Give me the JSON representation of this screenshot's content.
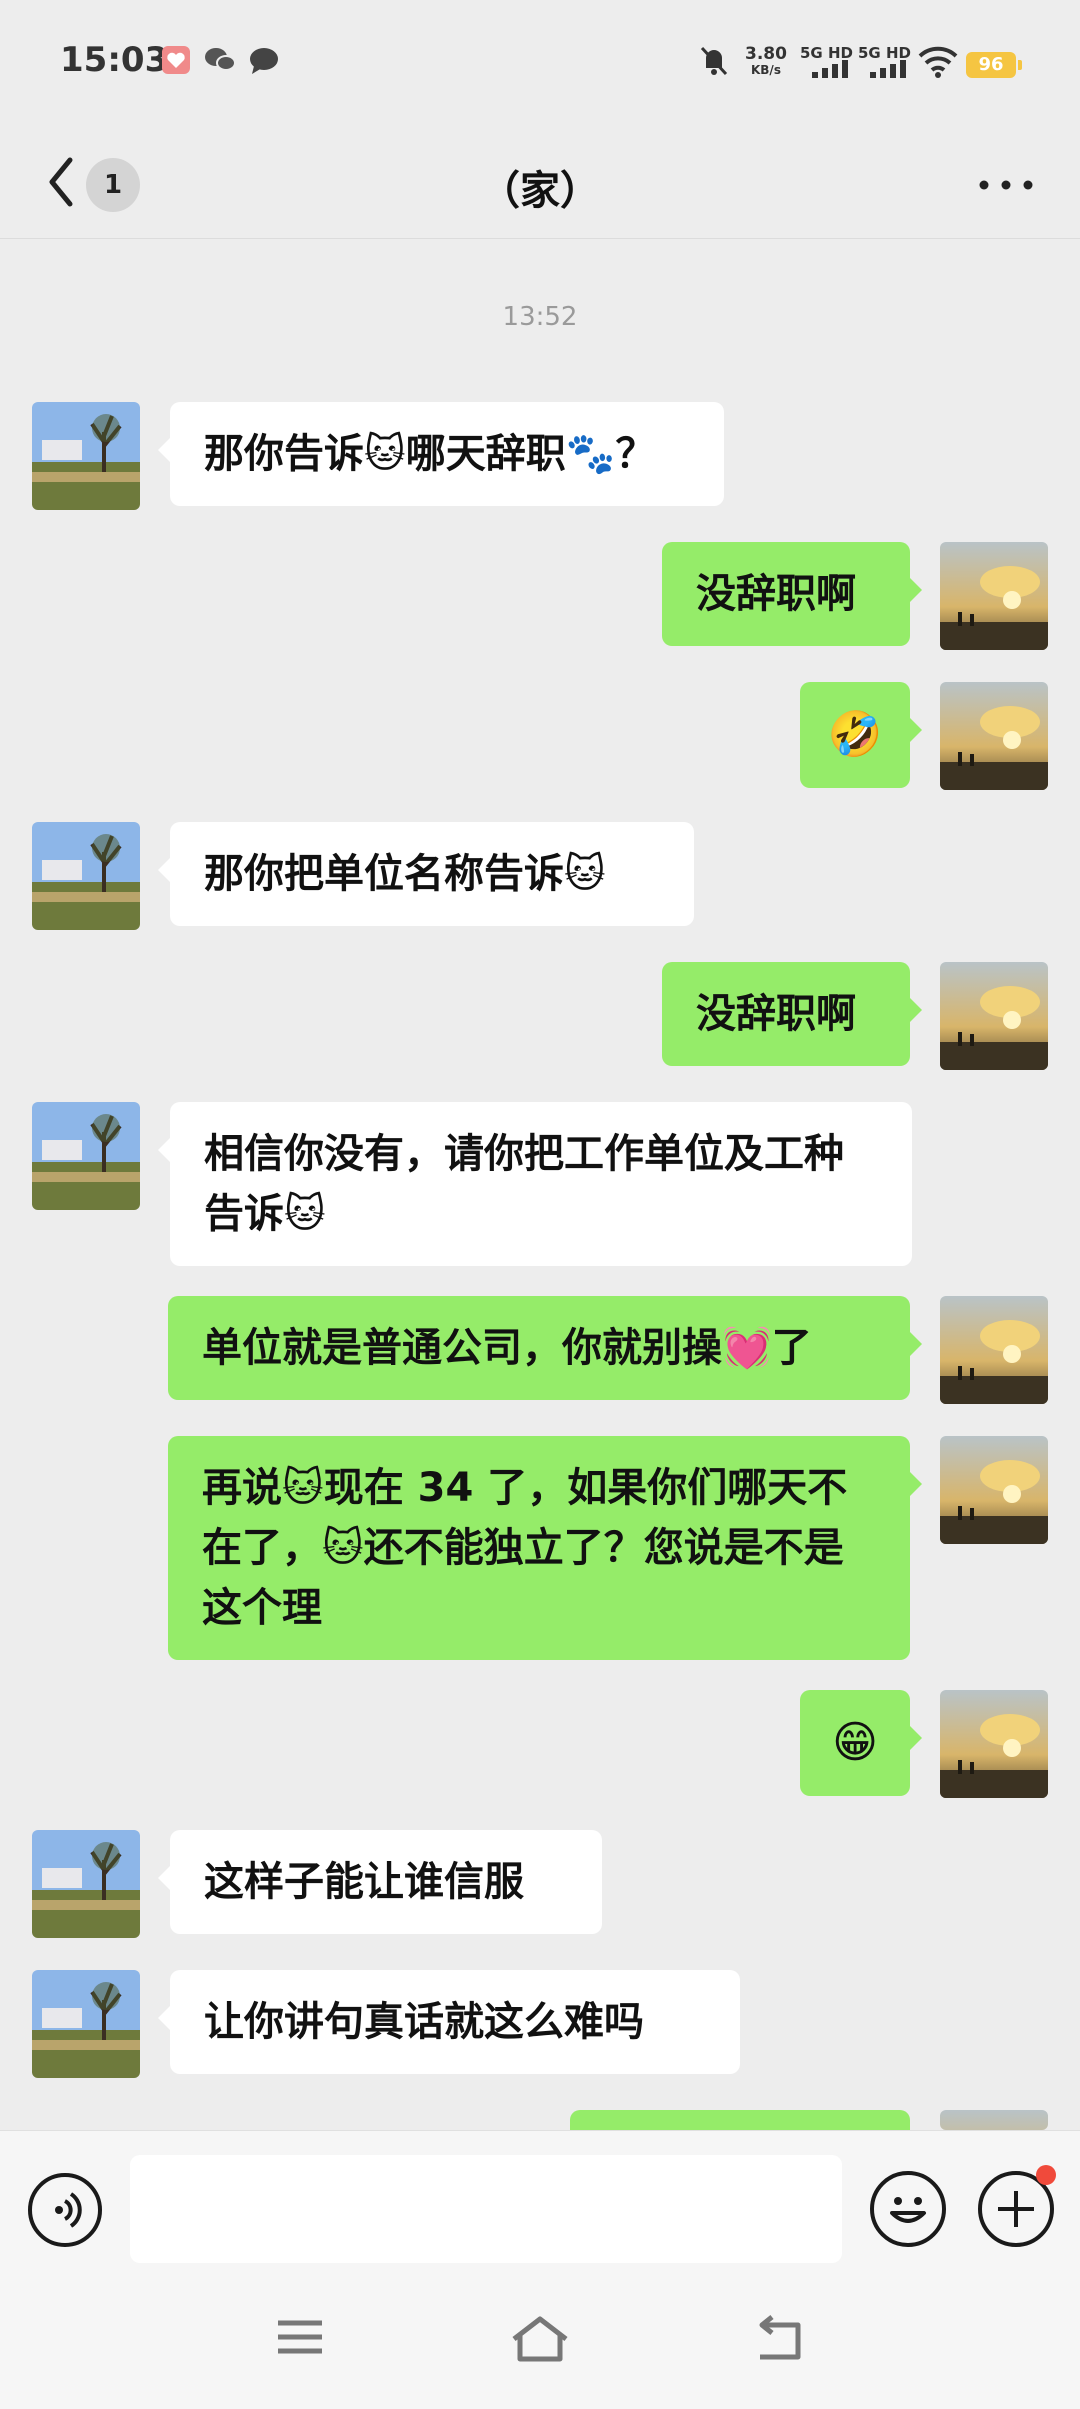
{
  "status_bar": {
    "time": "15:03",
    "speed_value": "3.80",
    "speed_unit": "KB/s",
    "sim1": "5G HD",
    "sim2": "5G HD",
    "battery": "96"
  },
  "header": {
    "unread_count": "1",
    "title": "（家）"
  },
  "chat": {
    "timestamp": "13:52",
    "messages": [
      {
        "side": "in",
        "text": "那你告诉🐱哪天辞职🐾？"
      },
      {
        "side": "out",
        "text": "没辞职啊"
      },
      {
        "side": "out",
        "text": "🤣"
      },
      {
        "side": "in",
        "text": "那你把单位名称告诉🐱"
      },
      {
        "side": "out",
        "text": "没辞职啊"
      },
      {
        "side": "in",
        "text": "相信你没有，请你把工作单位及工种告诉🐱"
      },
      {
        "side": "out",
        "text": "单位就是普通公司，你就别操💓了"
      },
      {
        "side": "out",
        "text": "再说🐱现在 34 了，如果你们哪天不在了，🐱还不能独立了？您说是不是这个理"
      },
      {
        "side": "out",
        "text": "😁"
      },
      {
        "side": "in",
        "text": "这样子能让谁信服"
      },
      {
        "side": "in",
        "text": "让你讲句真话就这么难吗"
      }
    ]
  },
  "input": {
    "value": "",
    "placeholder": ""
  },
  "icons": {
    "back": "chevron-left-icon",
    "more": "more-dots-icon",
    "voice": "voice-icon",
    "emoji": "smile-icon",
    "plus": "plus-icon",
    "nav_menu": "menu-icon",
    "nav_home": "home-icon",
    "nav_back": "back-icon"
  },
  "colors": {
    "background": "#EDEDED",
    "outgoing_bubble": "#95EC69",
    "incoming_bubble": "#FFFFFF",
    "battery": "#F5C542",
    "notification_dot": "#F04A3B"
  }
}
